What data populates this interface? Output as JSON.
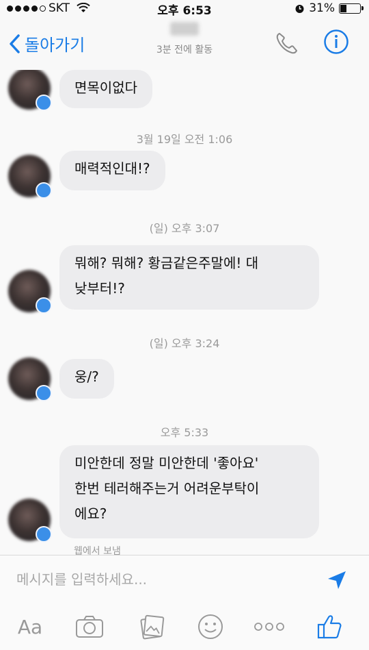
{
  "status_bar": {
    "carrier": "SKT",
    "time": "오후 6:53",
    "battery": "31%",
    "battery_level": 0.31
  },
  "nav": {
    "back_label": "돌아가기",
    "contact_status": "3분 전에 활동"
  },
  "messages": [
    {
      "type": "bubble",
      "text": "면목이없다"
    },
    {
      "type": "timestamp",
      "text": "3월 19일 오전 1:06"
    },
    {
      "type": "bubble",
      "text": "매력적인대!?"
    },
    {
      "type": "timestamp",
      "text": "(일) 오후 3:07"
    },
    {
      "type": "bubble",
      "text": "뭐해? 뭐해? 황금같은주말에! 대\n낮부터!?"
    },
    {
      "type": "timestamp",
      "text": "(일) 오후 3:24"
    },
    {
      "type": "bubble",
      "text": "웅/?"
    },
    {
      "type": "timestamp",
      "text": "오후 5:33"
    },
    {
      "type": "bubble",
      "text": "미안한데 정말 미안한데 '좋아요'\n한번 테러해주는거 어려운부탁이\n에요?"
    }
  ],
  "sent_from": "웹에서 보냄",
  "composer": {
    "placeholder": "메시지를 입력하세요...",
    "text_tool_label": "Aa"
  },
  "colors": {
    "accent": "#1a7ce6",
    "bubble": "#ececee"
  },
  "icons": [
    "back-chevron-icon",
    "phone-icon",
    "info-icon",
    "send-icon",
    "camera-icon",
    "gallery-icon",
    "emoji-icon",
    "more-icon",
    "like-icon"
  ]
}
